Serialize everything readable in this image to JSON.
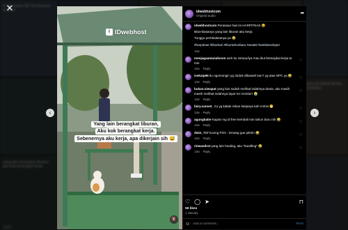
{
  "background_tiles": [
    {
      "text": "Programmer\nSD The Eeeeeel Enaurel",
      "count": "",
      "color": "#3d4a5c"
    },
    {
      "text": "",
      "count": "",
      "color": "#2e3a45"
    },
    {
      "text": "",
      "count": "",
      "color": "#3a3f36"
    },
    {
      "text": "",
      "count": "",
      "color": "#4a4740"
    },
    {
      "text": "",
      "count": "",
      "color": "#3b4a5a"
    },
    {
      "text": "",
      "count": "",
      "color": "#2f4540"
    },
    {
      "text": "",
      "count": "",
      "color": "#36423d"
    },
    {
      "text": "",
      "count": "",
      "color": "#3f3a33"
    },
    {
      "text": "",
      "count": "",
      "color": "#47443e"
    },
    {
      "text": "SIKLUS HIDUP\nBUNG DEWASA",
      "count": "",
      "color": "#514a3f"
    },
    {
      "text": "yang lain berangkat liburan, aku kok berangkat kerja",
      "count": "3,007",
      "color": "#2b3c35"
    },
    {
      "text": "",
      "count": "",
      "color": "#2c3538"
    },
    {
      "text": "",
      "count": "",
      "color": "#3a4238"
    },
    {
      "text": "",
      "count": "",
      "color": "#2e3236"
    },
    {
      "text": "",
      "count": "",
      "color": "#3c3f45"
    }
  ],
  "close_label": "✕",
  "post": {
    "watermark": "IDwebhost",
    "caption_lines": [
      "Yang lain berangkat liburan,",
      "Aku kok berangkat kerja.",
      "Sebenernya aku kerja, apa dikerjain sih 😅"
    ]
  },
  "header": {
    "username": "idwebhostcom",
    "subtitle": "Original audio",
    "more_label": "•••"
  },
  "caption": {
    "username": "idwebhostcom",
    "text": "Perasaan hari ini HARPITNAS 😆",
    "line2": "Bisa-biasanya yang lain liburan aku kerja",
    "line3": "Tunggu pembalasanya ya 😂",
    "hashtags": "#harpitnas #liburkan #liburtahunbaru #anakti #webdeveloper",
    "time": "14w"
  },
  "comments": [
    {
      "user": "menjagaamanahcom",
      "text": "woh itu mimpu/iya mau ikut berangkat kerja ta min",
      "time": "14w",
      "reply": "Reply"
    },
    {
      "user": "isekaip69",
      "text": "itu ngomongin yg duduk dibawah kan? yg atas NPC ya 😂",
      "time": "14w",
      "reply": "Reply"
    },
    {
      "user": "bukan.siwapat",
      "text": "yang lain sudah melihat indahnya dunia, aku masih masih melihat indahnya layar tor montiorr 😭",
      "time": "14w",
      "reply": "Reply"
    },
    {
      "user": "fairy.sunset_",
      "text": "itu yg kakak rekan kerjanya kah mimin 😁",
      "time": "14w",
      "reply": "Reply"
    },
    {
      "user": "agungbabe",
      "text": "Kapan mg id free kembali min tahun baru nih 😂",
      "time": "14w",
      "reply": "Reply"
    },
    {
      "user": "dwin_717",
      "text": "kucing POV : Emang gue pikirin 😂",
      "time": "14w",
      "reply": "Reply"
    },
    {
      "user": "riewandrst",
      "text": "yang lain healing, aku \"handling\" 😂",
      "time": "14w",
      "reply": "Reply"
    }
  ],
  "actions": {
    "likes": "59 likes",
    "ago": "1 January"
  },
  "composer": {
    "placeholder": "Add a comment...",
    "post_label": "Post"
  }
}
